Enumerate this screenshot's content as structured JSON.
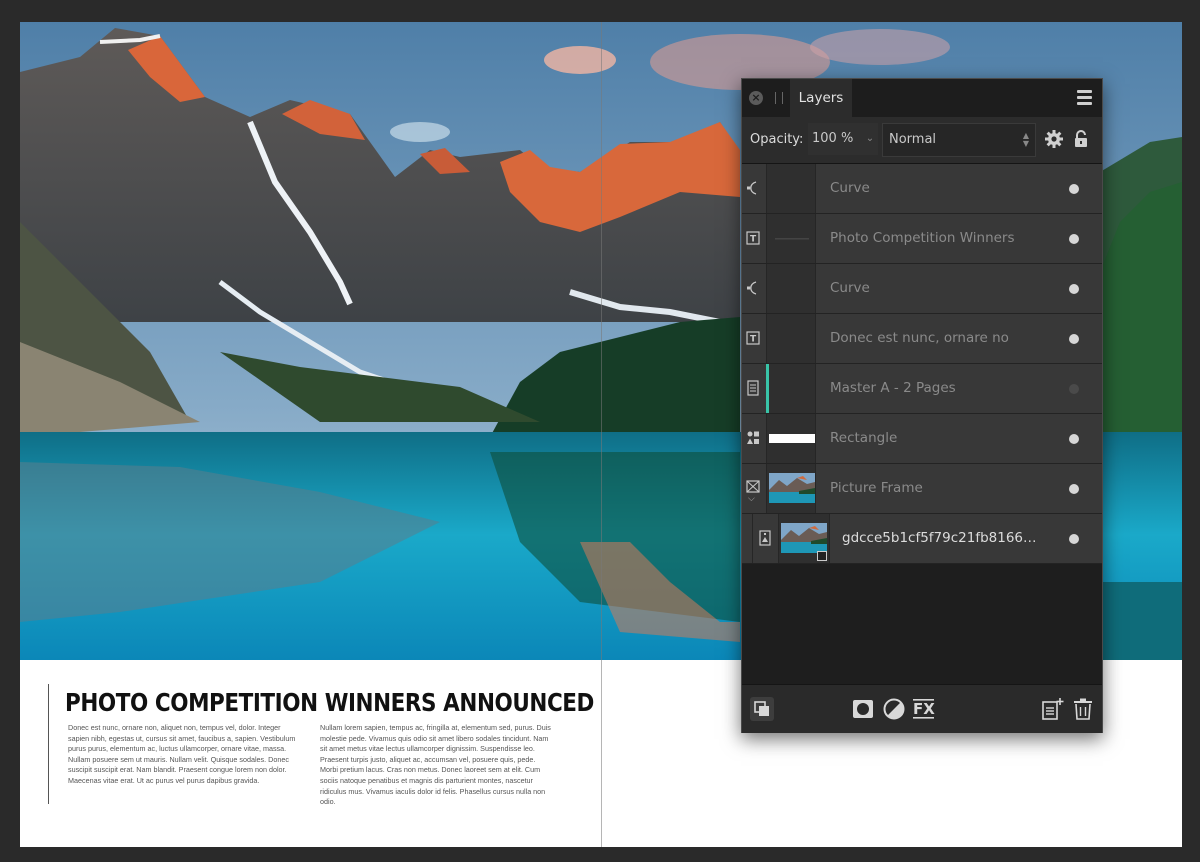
{
  "article": {
    "headline": "PHOTO COMPETITION WINNERS ANNOUNCED",
    "body_col1": "Donec est nunc, ornare non, aliquet non, tempus vel, dolor. Integer sapien nibh, egestas ut, cursus sit amet, faucibus a, sapien. Vestibulum purus purus, elementum ac, luctus ullamcorper, ornare vitae, massa. Nullam posuere sem ut mauris. Nullam velit. Quisque sodales. Donec suscipit suscipit erat. Nam blandit. Praesent congue lorem non dolor. Maecenas vitae erat. Ut ac purus vel purus dapibus gravida.",
    "body_col2": "Nullam lorem sapien, tempus ac, fringilla at, elementum sed, purus. Duis molestie pede. Vivamus quis odio sit amet libero sodales tincidunt. Nam sit amet metus vitae lectus ullamcorper dignissim. Suspendisse leo. Praesent turpis justo, aliquet ac, accumsan vel, posuere quis, pede. Morbi pretium lacus. Cras non metus. Donec laoreet sem at elit. Cum sociis natoque penatibus et magnis dis parturient montes, nascetur ridiculus mus. Vivamus iaculis dolor id felis. Phasellus cursus nulla non odio."
  },
  "panel": {
    "tab_label": "Layers",
    "close_glyph": "×",
    "opacity_label": "Opacity:",
    "opacity_value": "100 %",
    "blend_mode": "Normal",
    "layers": [
      {
        "name": "Curve",
        "icon": "curve-icon",
        "thumb": "empty",
        "visible": true
      },
      {
        "name": "Photo Competition Winners",
        "icon": "text-frame-icon",
        "thumb": "text",
        "visible": true
      },
      {
        "name": "Curve",
        "icon": "curve-icon",
        "thumb": "empty",
        "visible": true
      },
      {
        "name": "Donec est nunc, ornare no",
        "icon": "text-frame-icon",
        "thumb": "empty",
        "visible": true
      },
      {
        "name": "Master A - 2 Pages",
        "icon": "master-page-icon",
        "thumb": "empty",
        "visible": false,
        "selected_accent": "#39c4a8"
      },
      {
        "name": "Rectangle",
        "icon": "shape-icon",
        "thumb": "white-bar",
        "visible": true
      },
      {
        "name": "Picture Frame",
        "icon": "picture-frame-icon",
        "thumb": "photo",
        "visible": true,
        "expanded": true
      },
      {
        "name": "gdcce5b1cf5f79c21fb8166…",
        "icon": "image-icon",
        "thumb": "photo",
        "visible": true,
        "child": true
      }
    ],
    "bottom_icons": [
      "arrange-icon",
      "mask-icon",
      "adjustment-icon",
      "fx-icon",
      "add-page-icon",
      "trash-icon"
    ]
  }
}
